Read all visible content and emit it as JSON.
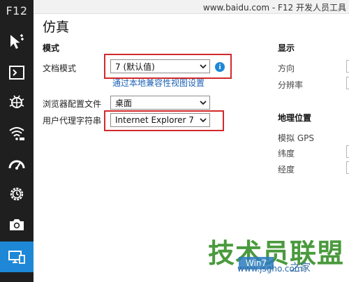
{
  "window": {
    "brand": "F12",
    "title": "www.baidu.com - F12 开发人员工具"
  },
  "sidebar": {
    "items": [
      {
        "name": "dom-explorer",
        "icon": "cursor-select-icon",
        "active": false
      },
      {
        "name": "console",
        "icon": "console-icon",
        "active": false
      },
      {
        "name": "debugger",
        "icon": "bug-icon",
        "active": false
      },
      {
        "name": "network",
        "icon": "wifi-icon",
        "active": false
      },
      {
        "name": "performance",
        "icon": "gauge-icon",
        "active": false
      },
      {
        "name": "memory",
        "icon": "gear-clock-icon",
        "active": false
      },
      {
        "name": "screenshot",
        "icon": "camera-icon",
        "active": false
      },
      {
        "name": "emulation",
        "icon": "devices-icon",
        "active": true
      }
    ],
    "active_color": "#1e88d6"
  },
  "page": {
    "title": "仿真"
  },
  "mode": {
    "heading": "模式",
    "document_mode_label": "文档模式",
    "document_mode_value": "7 (默认值)",
    "compat_link": "通过本地兼容性视图设置",
    "browser_profile_label": "浏览器配置文件",
    "browser_profile_value": "桌面",
    "user_agent_label": "用户代理字符串",
    "user_agent_value": "Internet Explorer 7"
  },
  "display": {
    "heading": "显示",
    "orientation_label": "方向",
    "resolution_label": "分辨率"
  },
  "geolocation": {
    "heading": "地理位置",
    "simulate_gps_label": "模拟 GPS",
    "latitude_label": "纬度",
    "longitude_label": "经度"
  },
  "watermark": {
    "main": "技术员联盟",
    "badge": "Win7",
    "url": "www.jsgho.com",
    "site": "之家"
  },
  "colors": {
    "highlight": "#d22a2a",
    "link": "#1e63b6",
    "sidebar_bg": "#1f1f1f"
  }
}
